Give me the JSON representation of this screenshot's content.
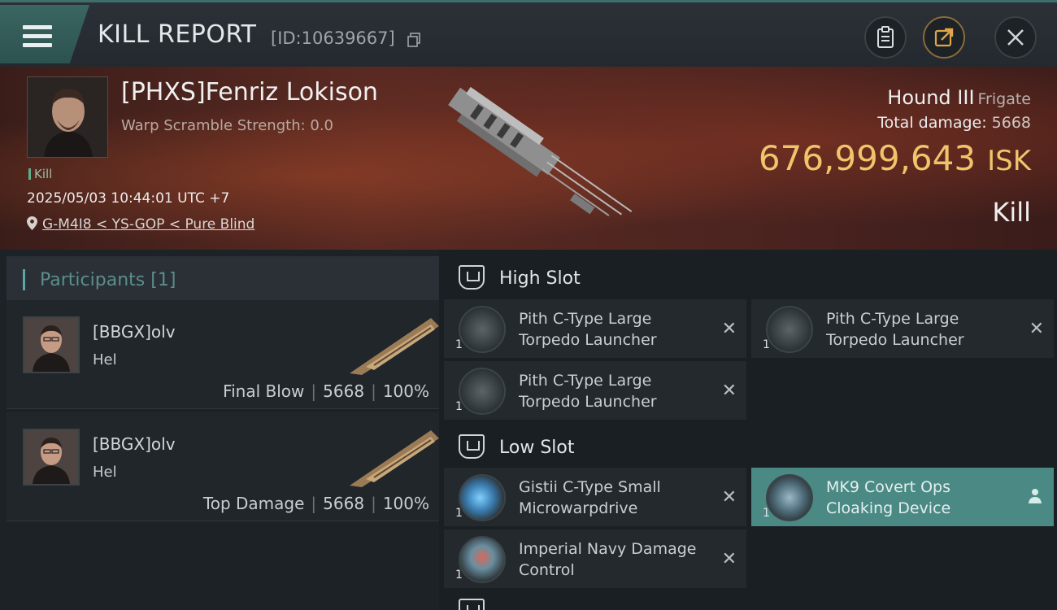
{
  "header": {
    "title": "KILL REPORT",
    "kill_id": "[ID:10639667]"
  },
  "victim": {
    "name": "[PHXS]Fenriz Lokison",
    "scramble": "Warp Scramble Strength: 0.0",
    "kill_tag": "Kill",
    "datetime": "2025/05/03 10:44:01 UTC +7",
    "location": "G-M4I8 < YS-GOP < Pure Blind",
    "ship": "Hound III",
    "ship_class": "Frigate",
    "total_damage_label": "Total damage:",
    "total_damage": "5668",
    "isk_value": "676,999,643",
    "isk_unit": "ISK",
    "status": "Kill"
  },
  "participants": {
    "title": "Participants",
    "count": "[1]",
    "rows": [
      {
        "name": "[BBGX]olv",
        "ship": "Hel",
        "role": "Final Blow",
        "damage": "5668",
        "percent": "100%"
      },
      {
        "name": "[BBGX]olv",
        "ship": "Hel",
        "role": "Top Damage",
        "damage": "5668",
        "percent": "100%"
      }
    ]
  },
  "fittings": {
    "high_slot": {
      "title": "High Slot",
      "modules": [
        {
          "name": "Pith C-Type Large Torpedo Launcher",
          "qty": "1"
        },
        {
          "name": "Pith C-Type Large Torpedo Launcher",
          "qty": "1"
        },
        {
          "name": "Pith C-Type Large Torpedo Launcher",
          "qty": "1"
        }
      ]
    },
    "low_slot": {
      "title": "Low Slot",
      "modules": [
        {
          "name": "Gistii C-Type Small Microwarpdrive",
          "qty": "1"
        },
        {
          "name": "MK9 Covert Ops Cloaking Device",
          "qty": "1"
        },
        {
          "name": "Imperial Navy Damage Control",
          "qty": "1"
        }
      ]
    }
  },
  "icons": {
    "x_mark": "✕"
  },
  "colors": {
    "accent_teal": "#4b8985",
    "isk_gold": "#efc46a"
  }
}
